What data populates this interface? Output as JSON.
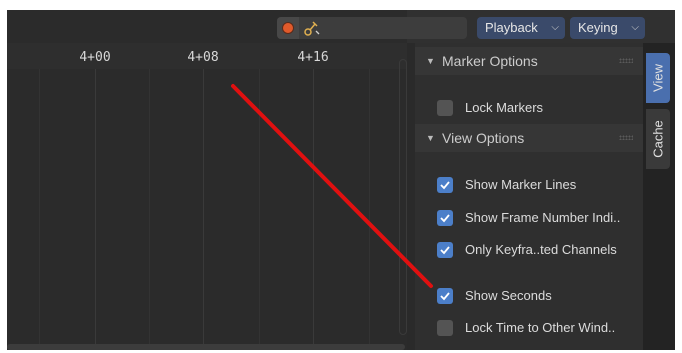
{
  "header": {
    "record_icon": "record-circle-icon",
    "keying_icon": "keying-set-icon",
    "playback_label": "Playback",
    "keying_label": "Keying"
  },
  "timeline": {
    "ticks": [
      "4+00",
      "4+08",
      "4+16"
    ]
  },
  "sidebar": {
    "marker_options": {
      "title": "Marker Options",
      "items": [
        {
          "label": "Lock Markers",
          "checked": false
        }
      ]
    },
    "view_options": {
      "title": "View Options",
      "items": [
        {
          "label": "Show Marker Lines",
          "checked": true
        },
        {
          "label": "Show Frame Number Indi..",
          "checked": true
        },
        {
          "label": "Only Keyfra..ted Channels",
          "checked": true
        },
        {
          "label": "Show Seconds",
          "checked": true
        },
        {
          "label": "Lock Time to Other Wind..",
          "checked": false
        }
      ]
    }
  },
  "tabs": {
    "view": "View",
    "cache": "Cache"
  },
  "colors": {
    "accent": "#4c7fc9",
    "annotation": "#e01010",
    "record": "#e05a2b"
  }
}
